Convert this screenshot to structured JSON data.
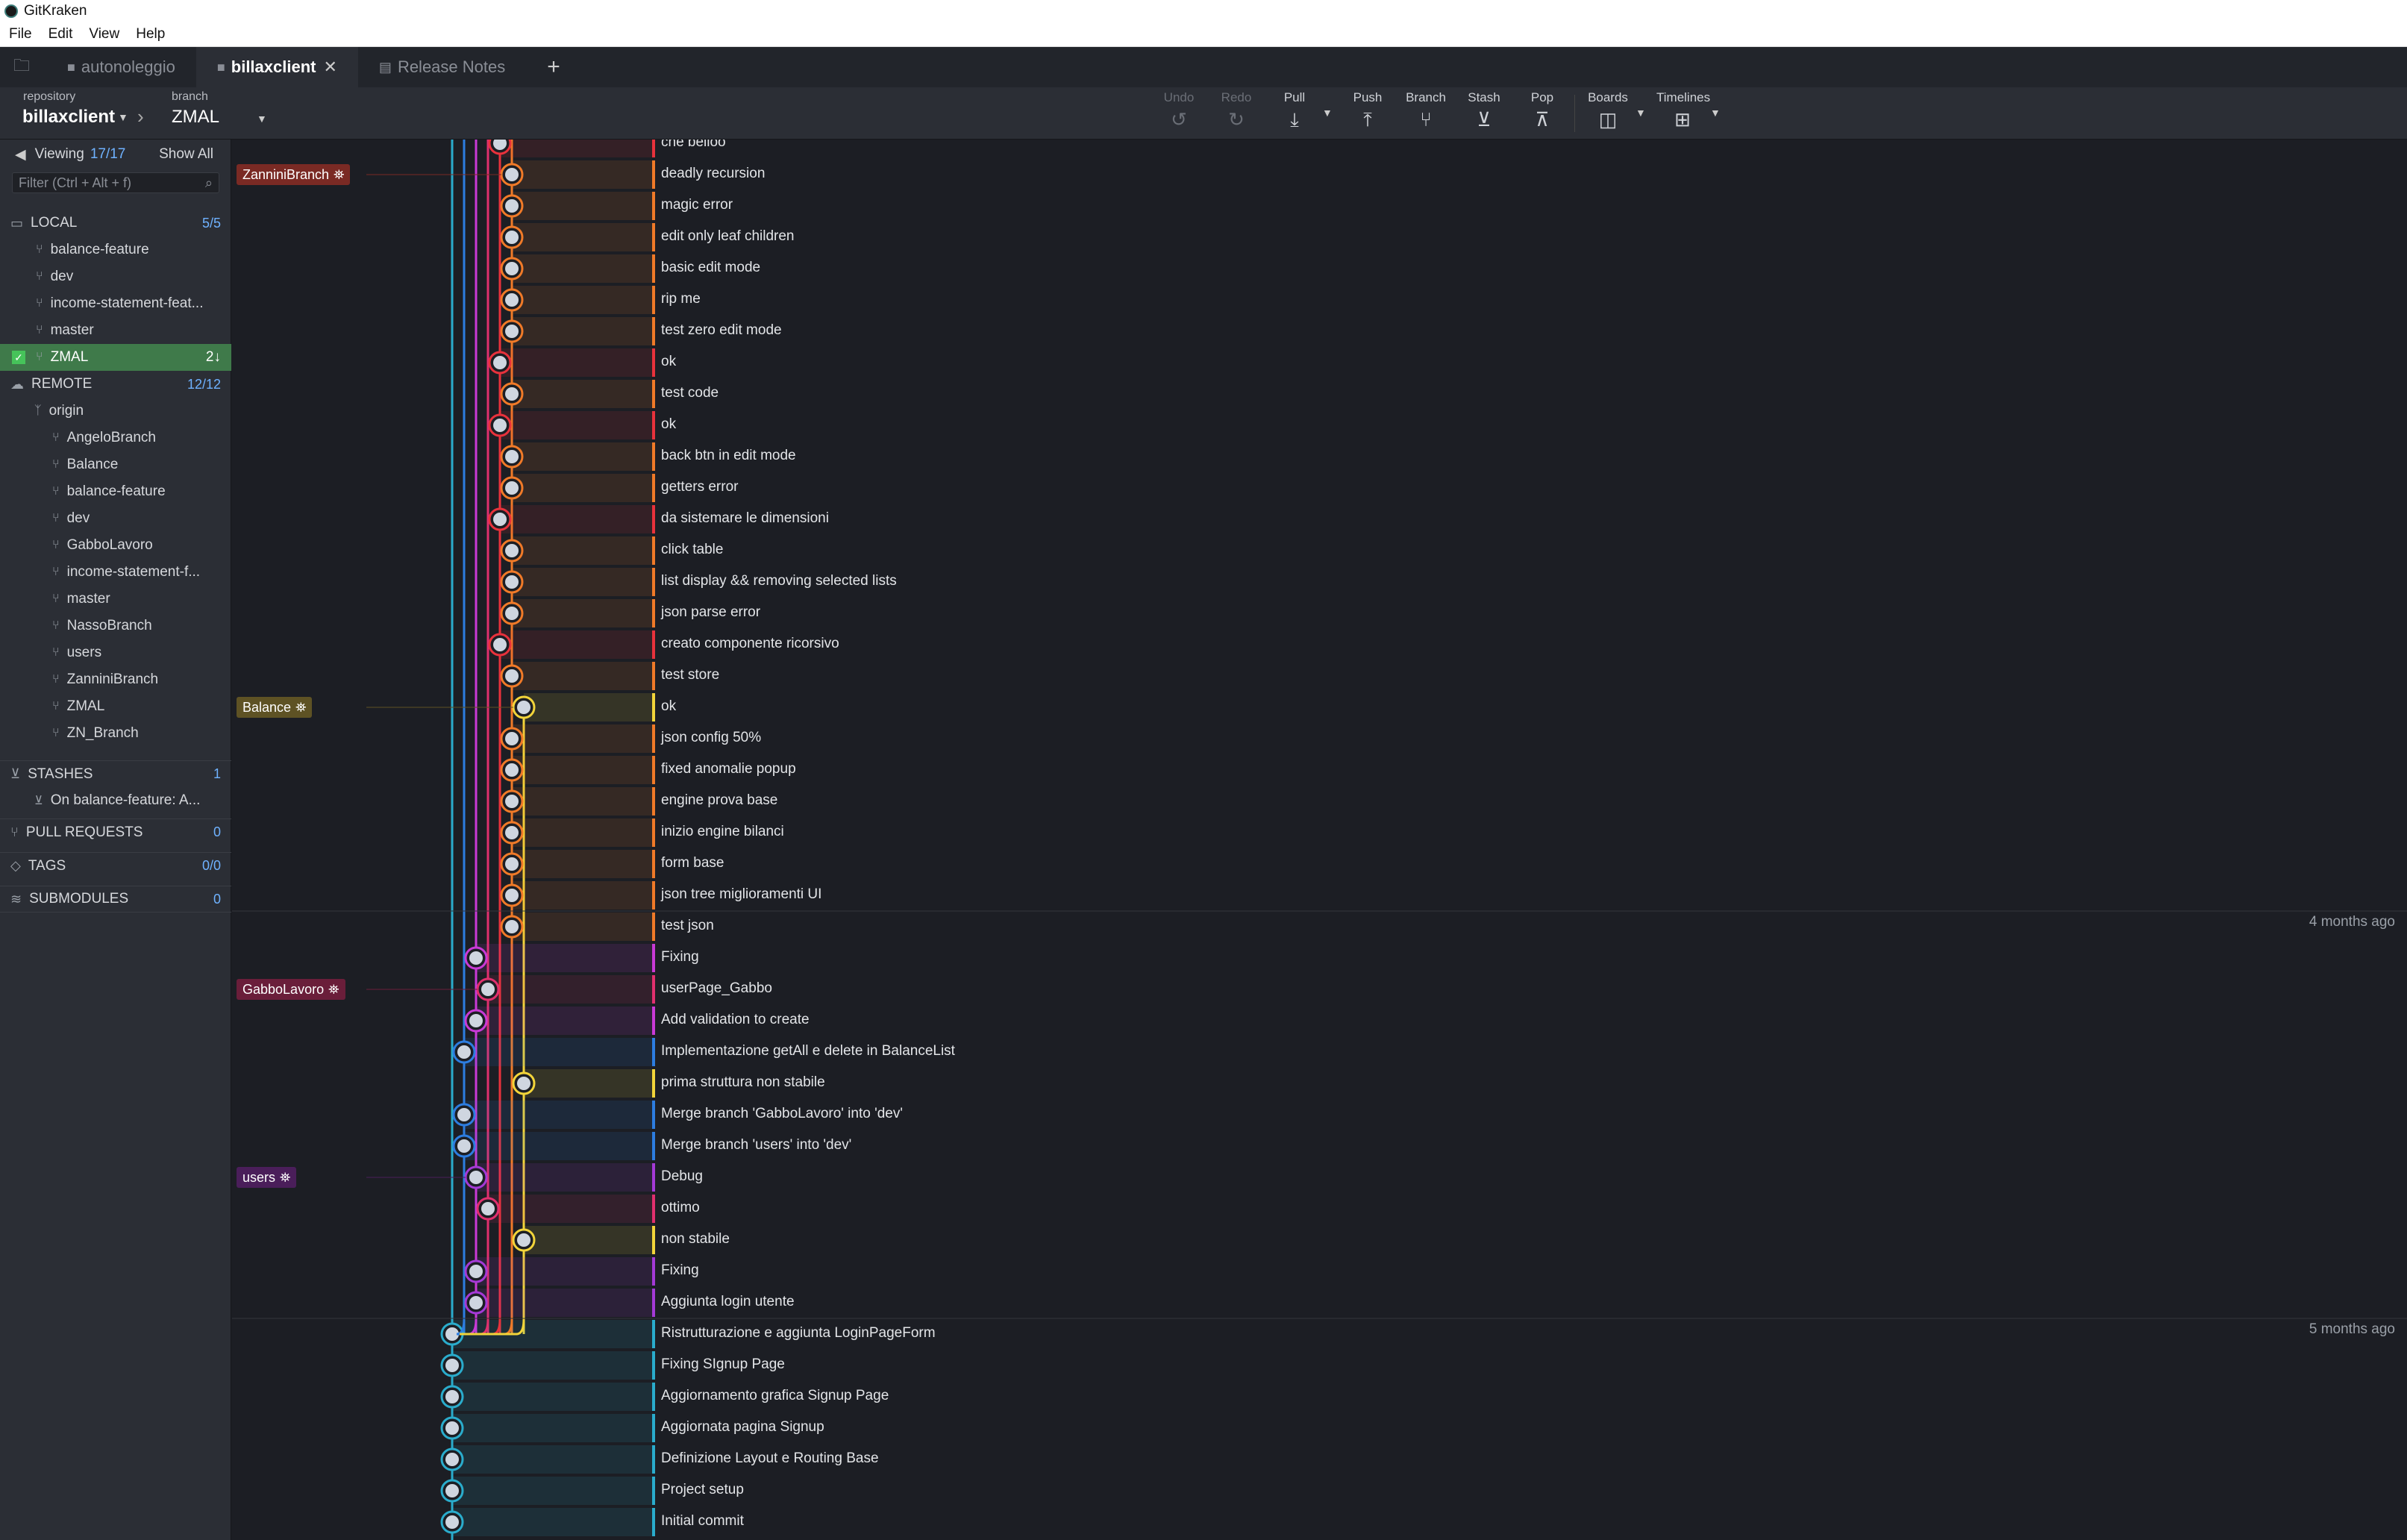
{
  "app": {
    "title": "GitKraken"
  },
  "menu": [
    "File",
    "Edit",
    "View",
    "Help"
  ],
  "tabs": [
    {
      "label": "autonoleggio",
      "active": false
    },
    {
      "label": "billaxclient",
      "active": true
    },
    {
      "label": "Release Notes",
      "active": false
    }
  ],
  "toolbar": {
    "repository_label": "repository",
    "repository_value": "billaxclient",
    "branch_label": "branch",
    "branch_value": "ZMAL",
    "buttons": [
      {
        "label": "Undo",
        "icon": "undo-icon",
        "enabled": false
      },
      {
        "label": "Redo",
        "icon": "redo-icon",
        "enabled": false
      },
      {
        "label": "Pull",
        "icon": "pull-icon",
        "enabled": true
      },
      {
        "label": "Push",
        "icon": "push-icon",
        "enabled": true
      },
      {
        "label": "Branch",
        "icon": "branch-icon",
        "enabled": true
      },
      {
        "label": "Stash",
        "icon": "stash-icon",
        "enabled": true
      },
      {
        "label": "Pop",
        "icon": "pop-icon",
        "enabled": true
      },
      {
        "label": "Boards",
        "icon": "boards-icon",
        "enabled": true
      },
      {
        "label": "Timelines",
        "icon": "timelines-icon",
        "enabled": true
      }
    ]
  },
  "sidebar": {
    "viewing_label": "Viewing",
    "viewing_count": "17/17",
    "show_all": "Show All",
    "filter_placeholder": "Filter (Ctrl + Alt + f)",
    "local": {
      "label": "LOCAL",
      "count": "5/5",
      "branches": [
        "balance-feature",
        "dev",
        "income-statement-feat...",
        "master"
      ]
    },
    "current_branch": {
      "label": "ZMAL",
      "badge": "2↓"
    },
    "remote": {
      "label": "REMOTE",
      "count": "12/12",
      "origin": "origin",
      "branches": [
        "AngeloBranch",
        "Balance",
        "balance-feature",
        "dev",
        "GabboLavoro",
        "income-statement-f...",
        "master",
        "NassoBranch",
        "users",
        "ZanniniBranch",
        "ZMAL",
        "ZN_Branch"
      ]
    },
    "stashes": {
      "label": "STASHES",
      "count": "1",
      "items": [
        "On balance-feature: A..."
      ]
    },
    "pull_requests": {
      "label": "PULL REQUESTS",
      "count": "0"
    },
    "tags": {
      "label": "TAGS",
      "count": "0/0"
    },
    "submodules": {
      "label": "SUBMODULES",
      "count": "0"
    }
  },
  "branch_tags": [
    {
      "label": "ZanniniBranch",
      "row": 1,
      "color": "#7a2a24"
    },
    {
      "label": "Balance",
      "row": 18,
      "color": "#5e5224"
    },
    {
      "label": "GabboLavoro",
      "row": 27,
      "color": "#6a1e3a"
    },
    {
      "label": "users",
      "row": 33,
      "color": "#4a1e5a"
    }
  ],
  "time_labels": [
    {
      "label": "4 months ago",
      "row": 25
    },
    {
      "label": "5 months ago",
      "row": 38
    }
  ],
  "commits": [
    {
      "message": "che belloo",
      "lane": 4,
      "color": "#e8323c"
    },
    {
      "message": "deadly recursion",
      "lane": 5,
      "color": "#f07a28"
    },
    {
      "message": "magic error",
      "lane": 5,
      "color": "#f07a28"
    },
    {
      "message": "edit only leaf children",
      "lane": 5,
      "color": "#f07a28"
    },
    {
      "message": "basic edit mode",
      "lane": 5,
      "color": "#f07a28"
    },
    {
      "message": "rip me",
      "lane": 5,
      "color": "#f07a28"
    },
    {
      "message": "test zero edit mode",
      "lane": 5,
      "color": "#f07a28"
    },
    {
      "message": "ok",
      "lane": 4,
      "color": "#e8323c"
    },
    {
      "message": "test code",
      "lane": 5,
      "color": "#f07a28"
    },
    {
      "message": "ok",
      "lane": 4,
      "color": "#e8323c"
    },
    {
      "message": "back btn in edit mode",
      "lane": 5,
      "color": "#f07a28"
    },
    {
      "message": "getters error",
      "lane": 5,
      "color": "#f07a28"
    },
    {
      "message": "da sistemare le dimensioni",
      "lane": 4,
      "color": "#e8323c"
    },
    {
      "message": "click table",
      "lane": 5,
      "color": "#f07a28"
    },
    {
      "message": "list display && removing selected lists",
      "lane": 5,
      "color": "#f07a28"
    },
    {
      "message": "json parse error",
      "lane": 5,
      "color": "#f07a28"
    },
    {
      "message": "creato componente ricorsivo",
      "lane": 4,
      "color": "#e8323c"
    },
    {
      "message": "test store",
      "lane": 5,
      "color": "#f07a28"
    },
    {
      "message": "ok",
      "lane": 6,
      "color": "#f2d43a"
    },
    {
      "message": "json config 50%",
      "lane": 5,
      "color": "#f07a28"
    },
    {
      "message": "fixed anomalie popup",
      "lane": 5,
      "color": "#f07a28"
    },
    {
      "message": "engine prova base",
      "lane": 5,
      "color": "#f07a28"
    },
    {
      "message": "inizio engine bilanci",
      "lane": 5,
      "color": "#f07a28"
    },
    {
      "message": "form base",
      "lane": 5,
      "color": "#f07a28"
    },
    {
      "message": "json tree miglioramenti UI",
      "lane": 5,
      "color": "#f07a28"
    },
    {
      "message": "test json",
      "lane": 5,
      "color": "#f07a28"
    },
    {
      "message": "Fixing",
      "lane": 2,
      "color": "#c93ad6"
    },
    {
      "message": "userPage_Gabbo",
      "lane": 3,
      "color": "#e0306e"
    },
    {
      "message": "Add validation to create",
      "lane": 2,
      "color": "#c93ad6"
    },
    {
      "message": "Implementazione getAll e delete in BalanceList",
      "lane": 1,
      "color": "#2d7de0"
    },
    {
      "message": "prima struttura non stabile",
      "lane": 6,
      "color": "#f2d43a"
    },
    {
      "message": "Merge branch 'GabboLavoro' into 'dev'",
      "lane": 1,
      "color": "#2d7de0"
    },
    {
      "message": "Merge branch 'users' into 'dev'",
      "lane": 1,
      "color": "#2d7de0"
    },
    {
      "message": "Debug",
      "lane": 2,
      "color": "#a43ad6"
    },
    {
      "message": "ottimo",
      "lane": 3,
      "color": "#e0306e"
    },
    {
      "message": "non stabile",
      "lane": 6,
      "color": "#f2d43a"
    },
    {
      "message": "Fixing",
      "lane": 2,
      "color": "#a43ad6"
    },
    {
      "message": "Aggiunta login utente",
      "lane": 2,
      "color": "#a43ad6"
    },
    {
      "message": "Ristrutturazione e aggiunta LoginPageForm",
      "lane": 0,
      "color": "#2aaccc"
    },
    {
      "message": "Fixing SIgnup Page",
      "lane": 0,
      "color": "#2aaccc"
    },
    {
      "message": "Aggiornamento grafica Signup Page",
      "lane": 0,
      "color": "#2aaccc"
    },
    {
      "message": "Aggiornata pagina Signup",
      "lane": 0,
      "color": "#2aaccc"
    },
    {
      "message": "Definizione Layout e Routing Base",
      "lane": 0,
      "color": "#2aaccc"
    },
    {
      "message": "Project setup",
      "lane": 0,
      "color": "#2aaccc"
    },
    {
      "message": "Initial commit",
      "lane": 0,
      "color": "#2aaccc"
    }
  ]
}
